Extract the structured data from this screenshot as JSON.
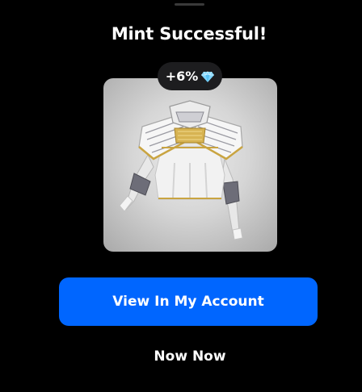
{
  "modal": {
    "title": "Mint Successful!",
    "bonus_label": "+6%",
    "bonus_icon": "diamond-icon",
    "item_image_icon": "armor-chestplate-icon",
    "primary_button_label": "View In My Account",
    "secondary_button_label": "Now Now"
  },
  "colors": {
    "background": "#000000",
    "accent": "#0066ff",
    "badge_background": "#1d1d1f",
    "card_background": "#d6d6d6"
  }
}
